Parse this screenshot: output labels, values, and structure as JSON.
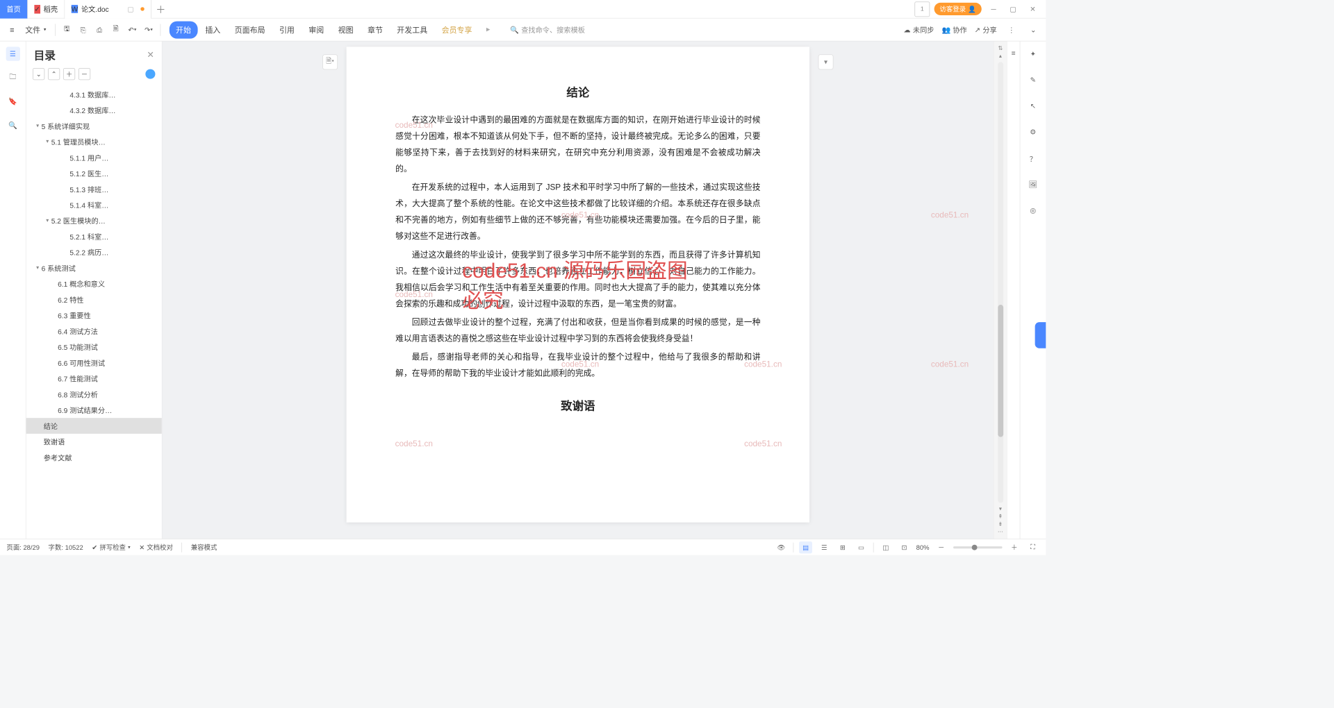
{
  "tabs": {
    "home": "首页",
    "docker": "稻壳",
    "doc": "论文.doc"
  },
  "titlebar": {
    "guest_login": "访客登录",
    "one_badge": "1"
  },
  "ribbon": {
    "file_label": "文件",
    "tabs": [
      "开始",
      "插入",
      "页面布局",
      "引用",
      "审阅",
      "视图",
      "章节",
      "开发工具",
      "会员专享"
    ],
    "active_tab": 0,
    "search_placeholder": "查找命令、搜索模板",
    "unsync": "未同步",
    "collab": "协作",
    "share": "分享"
  },
  "outline": {
    "title": "目录",
    "items": [
      {
        "lvl": 4,
        "text": "4.3.1 数据库…"
      },
      {
        "lvl": 4,
        "text": "4.3.2 数据库…"
      },
      {
        "lvl": 1,
        "text": "5 系统详细实现",
        "exp": true
      },
      {
        "lvl": 2,
        "text": "5.1 管理员模块…",
        "exp": true
      },
      {
        "lvl": 4,
        "text": "5.1.1 用户…"
      },
      {
        "lvl": 4,
        "text": "5.1.2 医生…"
      },
      {
        "lvl": 4,
        "text": "5.1.3 排班…"
      },
      {
        "lvl": 4,
        "text": "5.1.4 科室…"
      },
      {
        "lvl": 2,
        "text": "5.2 医生模块的…",
        "exp": true
      },
      {
        "lvl": 4,
        "text": "5.2.1 科室…"
      },
      {
        "lvl": 4,
        "text": "5.2.2 病历…"
      },
      {
        "lvl": 1,
        "text": "6 系统测试",
        "exp": true
      },
      {
        "lvl": 3,
        "text": "6.1 概念和意义"
      },
      {
        "lvl": 3,
        "text": "6.2 特性"
      },
      {
        "lvl": 3,
        "text": "6.3 重要性"
      },
      {
        "lvl": 3,
        "text": "6.4 测试方法"
      },
      {
        "lvl": 3,
        "text": "6.5 功能测试"
      },
      {
        "lvl": 3,
        "text": "6.6 可用性测试"
      },
      {
        "lvl": 3,
        "text": "6.7 性能测试"
      },
      {
        "lvl": 3,
        "text": "6.8 测试分析"
      },
      {
        "lvl": 3,
        "text": "6.9 测试结果分…"
      },
      {
        "lvl": 2,
        "text": "结论",
        "selected": true
      },
      {
        "lvl": 2,
        "text": "致谢语"
      },
      {
        "lvl": 2,
        "text": "参考文献"
      }
    ]
  },
  "document": {
    "h_conclusion": "结论",
    "p1": "在这次毕业设计中遇到的最困难的方面就是在数据库方面的知识，在刚开始进行毕业设计的时候感觉十分困难，根本不知道该从何处下手，但不断的坚持，设计最终被完成。无论多么的困难，只要能够坚持下来，善于去找到好的材料来研究，在研究中充分利用资源，没有困难是不会被成功解决的。",
    "p2": "在开发系统的过程中，本人运用到了 JSP 技术和平时学习中所了解的一些技术，通过实现这些技术，大大提高了整个系统的性能。在论文中这些技术都做了比较详细的介绍。本系统还存在很多缺点和不完善的地方，例如有些细节上做的还不够完善，有些功能模块还需要加强。在今后的日子里，能够对这些不足进行改善。",
    "p3": "通过这次最终的毕业设计，使我学到了很多学习中所不能学到的东西，而且获得了许多计算机知识。在整个设计过程中明白了许多东西，也培养独立工作能力，树立信心，对自己能力的工作能力。我相信以后会学习和工作生活中有着至关重要的作用。同时也大大提高了手的能力，使其难以充分体会探索的乐趣和成功的创作过程，设计过程中汲取的东西，是一笔宝贵的财富。",
    "p4": "回顾过去做毕业设计的整个过程，充满了付出和收获，但是当你看到成果的时候的感觉，是一种难以用言语表达的喜悦之感这些在毕业设计过程中学习到的东西将会使我终身受益！",
    "p5": "最后，感谢指导老师的关心和指导，在我毕业设计的整个过程中，他给与了我很多的帮助和讲解，在导师的帮助下我的毕业设计才能如此顺利的完成。",
    "h_thanks": "致谢语",
    "wm_small": "code51.cn",
    "wm_big": "code51.cn 源码乐园盗图必究"
  },
  "status": {
    "page": "页面: 28/29",
    "words": "字数: 10522",
    "spell": "拼写检查",
    "proof": "文档校对",
    "compat": "兼容模式",
    "zoom": "80%"
  }
}
